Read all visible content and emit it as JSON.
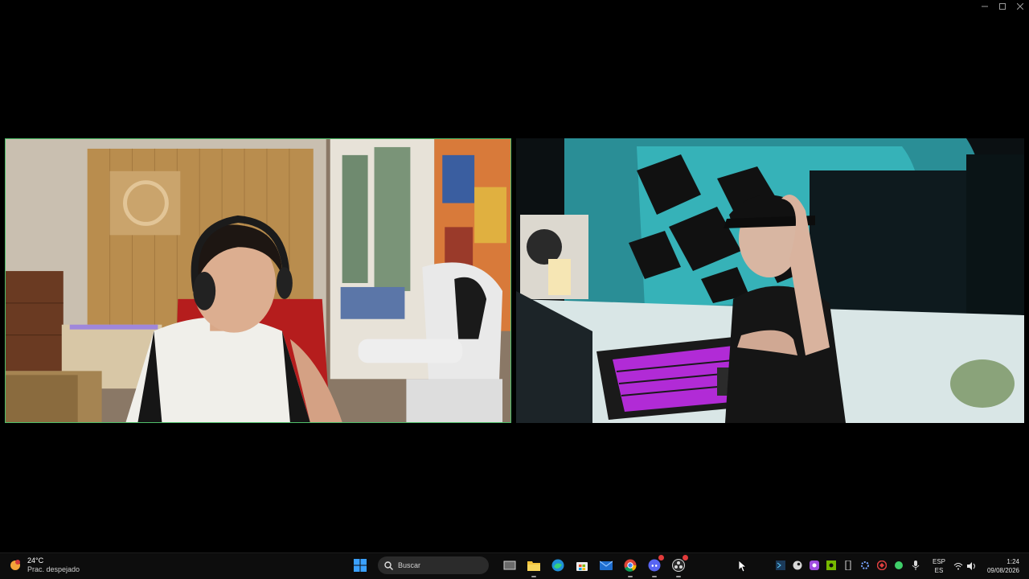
{
  "window": {
    "controls": [
      "minimize-icon",
      "maximize-icon",
      "close-icon"
    ]
  },
  "participants": [
    {
      "position": "left",
      "active_speaker": true,
      "accent_color": "#4fbf6a"
    },
    {
      "position": "right",
      "active_speaker": false,
      "accent_color": "#2fb8c4"
    }
  ],
  "taskbar": {
    "weather": {
      "temp": "24°C",
      "description": "Prac. despejado",
      "icon": "weather-sun-icon"
    },
    "search": {
      "placeholder": "Buscar"
    },
    "pinned_apps": [
      "start-icon",
      "task-view-icon",
      "file-explorer-icon",
      "edge-icon",
      "store-icon",
      "mail-icon",
      "chrome-icon",
      "discord-icon",
      "obs-icon"
    ],
    "tray_icons": [
      "terminal-icon",
      "steam-icon",
      "app-purple-icon",
      "nvidia-icon",
      "usb-icon",
      "settings-gear-icon",
      "antivirus-icon",
      "green-dot-icon",
      "microphone-icon"
    ],
    "language": {
      "primary": "ESP",
      "secondary": "ES"
    },
    "clock": {
      "time": "1:24",
      "date": "09/08/2026"
    }
  }
}
